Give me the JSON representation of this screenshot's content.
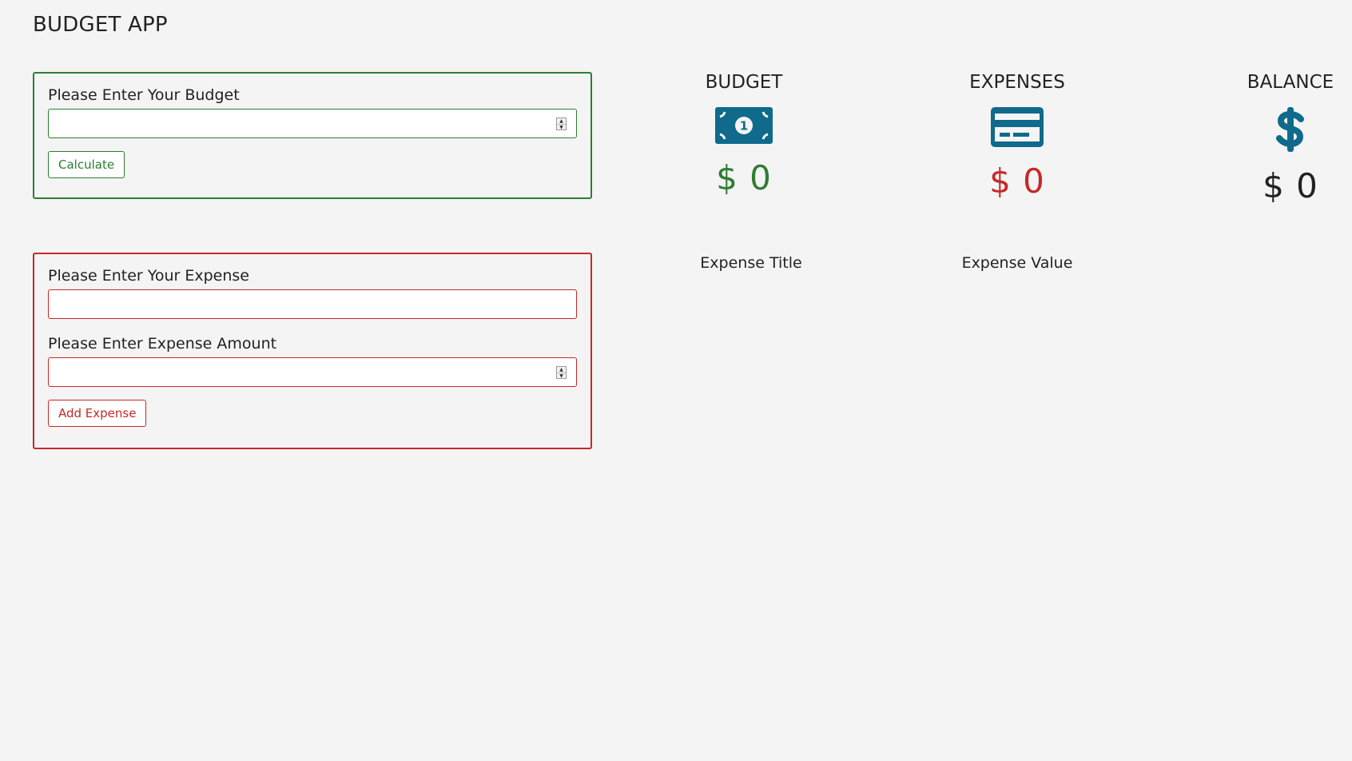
{
  "app": {
    "title": "BUDGET APP"
  },
  "budget_form": {
    "label": "Please Enter Your Budget",
    "input_value": "",
    "button_label": "Calculate"
  },
  "expense_form": {
    "title_label": "Please Enter Your Expense",
    "title_value": "",
    "amount_label": "Please Enter Expense Amount",
    "amount_value": "",
    "button_label": "Add Expense"
  },
  "summary": {
    "budget": {
      "title": "BUDGET",
      "icon": "money-bill-icon",
      "amount": "$ 0",
      "color": "#2e7d32"
    },
    "expenses": {
      "title": "EXPENSES",
      "icon": "credit-card-icon",
      "amount": "$ 0",
      "color": "#c62828"
    },
    "balance": {
      "title": "BALANCE",
      "icon": "dollar-sign-icon",
      "amount": "$ 0",
      "color": "#222222"
    }
  },
  "expense_list": {
    "headers": [
      "Expense Title",
      "Expense Value"
    ]
  },
  "colors": {
    "icon": "#0f6a8b",
    "green": "#2e7d32",
    "red": "#c62828",
    "background": "#f4f4f4"
  }
}
